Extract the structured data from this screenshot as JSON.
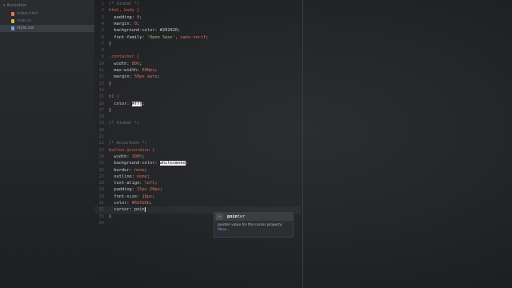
{
  "sidebar": {
    "project": "Accordion",
    "files": [
      {
        "name": "index.html",
        "color": "#e0765c",
        "active": false
      },
      {
        "name": "main.js",
        "color": "#d8b64c",
        "active": false
      },
      {
        "name": "style.css",
        "color": "#6aa7e0",
        "active": true
      }
    ]
  },
  "editor": {
    "line_numbers": [
      "1",
      "2",
      "3",
      "4",
      "5",
      "6",
      "7",
      "8",
      "9",
      "10",
      "11",
      "12",
      "13",
      "14",
      "15",
      "16",
      "17",
      "18",
      "19",
      "20",
      "21",
      "22",
      "23",
      "24",
      "25",
      "26",
      "27",
      "28",
      "29",
      "30",
      "31",
      "32",
      "33",
      "34"
    ],
    "lines": [
      [
        {
          "t": "/* Global ",
          "c": "c-comment"
        },
        {
          "t": "*/",
          "c": "c-comment"
        }
      ],
      [
        {
          "t": "html, body {",
          "c": "c-sel"
        }
      ],
      [
        {
          "t": "  padding: ",
          "c": "c-prop"
        },
        {
          "t": "0",
          "c": "c-val"
        },
        {
          "t": ";",
          "c": "c-prop"
        }
      ],
      [
        {
          "t": "  margin: ",
          "c": "c-prop"
        },
        {
          "t": "0",
          "c": "c-val"
        },
        {
          "t": ";",
          "c": "c-prop"
        }
      ],
      [
        {
          "t": "  background-color: #202020;",
          "c": "c-prop"
        }
      ],
      [
        {
          "t": "  font-family: ",
          "c": "c-prop"
        },
        {
          "t": "'Open Sans'",
          "c": "c-str"
        },
        {
          "t": ", ",
          "c": "c-prop"
        },
        {
          "t": "sans-serif",
          "c": "c-val"
        },
        {
          "t": ";",
          "c": "c-prop"
        }
      ],
      [
        {
          "t": "}",
          "c": "c-prop"
        }
      ],
      [],
      [
        {
          "t": ".container {",
          "c": "c-sel"
        }
      ],
      [
        {
          "t": "  width: ",
          "c": "c-prop"
        },
        {
          "t": "80%",
          "c": "c-val"
        },
        {
          "t": ";",
          "c": "c-prop"
        }
      ],
      [
        {
          "t": "  max-width: ",
          "c": "c-prop"
        },
        {
          "t": "600px",
          "c": "c-val"
        },
        {
          "t": ";",
          "c": "c-prop"
        }
      ],
      [
        {
          "t": "  margin: ",
          "c": "c-prop"
        },
        {
          "t": "50px auto",
          "c": "c-val"
        },
        {
          "t": ";",
          "c": "c-prop"
        }
      ],
      [
        {
          "t": "}",
          "c": "c-prop"
        }
      ],
      [],
      [
        {
          "t": "h1 {",
          "c": "c-sel"
        }
      ],
      [
        {
          "t": "  color: ",
          "c": "c-prop"
        },
        {
          "t": "#fff",
          "c": "c-hi"
        },
        {
          "t": ";",
          "c": "c-prop"
        }
      ],
      [
        {
          "t": "}",
          "c": "c-prop"
        }
      ],
      [],
      [
        {
          "t": "/* Global */",
          "c": "c-comment"
        }
      ],
      [],
      [],
      [
        {
          "t": "/* Accordion */",
          "c": "c-comment"
        }
      ],
      [
        {
          "t": "button.accordion {",
          "c": "c-sel"
        }
      ],
      [
        {
          "t": "  width: ",
          "c": "c-prop"
        },
        {
          "t": "100%",
          "c": "c-val"
        },
        {
          "t": ";",
          "c": "c-prop"
        }
      ],
      [
        {
          "t": "  background-color: ",
          "c": "c-prop"
        },
        {
          "t": "whitesmoke",
          "c": "c-hi"
        },
        {
          "t": ";",
          "c": "c-prop"
        }
      ],
      [
        {
          "t": "  border: ",
          "c": "c-prop"
        },
        {
          "t": "none",
          "c": "c-val"
        },
        {
          "t": ";",
          "c": "c-prop"
        }
      ],
      [
        {
          "t": "  outline: ",
          "c": "c-prop"
        },
        {
          "t": "none",
          "c": "c-val"
        },
        {
          "t": ";",
          "c": "c-prop"
        }
      ],
      [
        {
          "t": "  text-align: ",
          "c": "c-prop"
        },
        {
          "t": "left",
          "c": "c-val"
        },
        {
          "t": ";",
          "c": "c-prop"
        }
      ],
      [
        {
          "t": "  padding: ",
          "c": "c-prop"
        },
        {
          "t": "15px 20px",
          "c": "c-val"
        },
        {
          "t": ";",
          "c": "c-prop"
        }
      ],
      [
        {
          "t": "  font-size: ",
          "c": "c-prop"
        },
        {
          "t": "18px",
          "c": "c-val"
        },
        {
          "t": ";",
          "c": "c-prop"
        }
      ],
      [
        {
          "t": "  color: ",
          "c": "c-prop"
        },
        {
          "t": "#5b5b5b",
          "c": "c-val"
        },
        {
          "t": ";",
          "c": "c-prop"
        }
      ],
      [
        {
          "t": "  cursor: ",
          "c": "c-prop"
        },
        {
          "t": "poin",
          "c": "c-prop"
        },
        {
          "t": "",
          "c": "cursor"
        }
      ],
      [
        {
          "t": "}",
          "c": "c-prop"
        }
      ],
      []
    ],
    "active_line_index": 31
  },
  "hint": {
    "badge": "≡",
    "match": "poin",
    "rest": "ter",
    "description": "pointer value for the cursor property",
    "more": "More..."
  }
}
